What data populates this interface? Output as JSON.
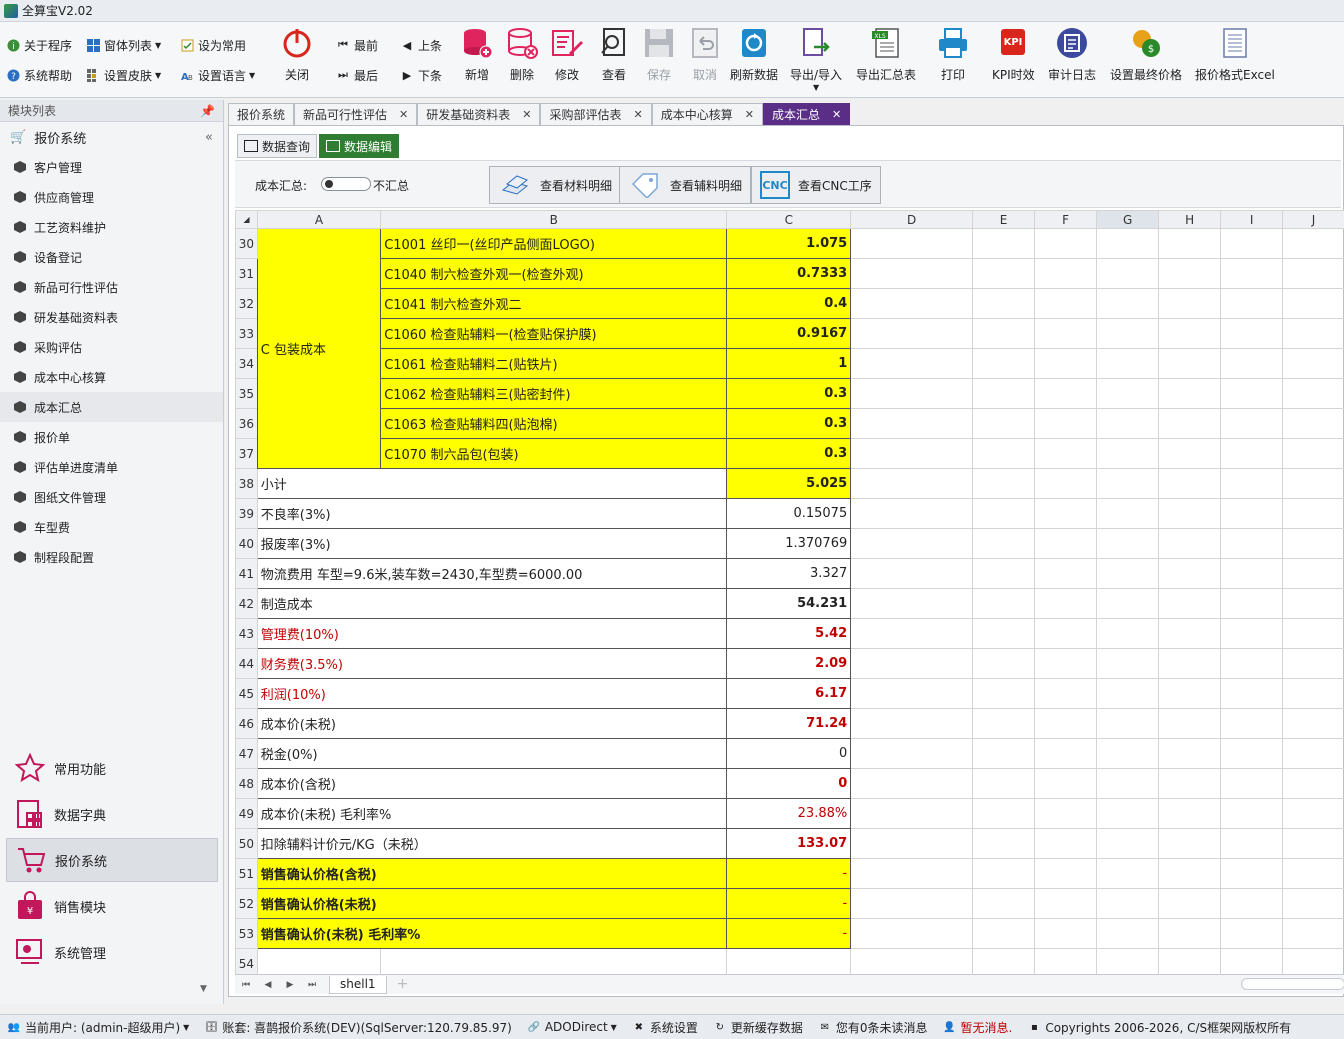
{
  "app": {
    "title": "全算宝V2.02"
  },
  "toolbar": {
    "small": [
      {
        "label": "关于程序",
        "icon": "info-icon",
        "caret": false
      },
      {
        "label": "窗体列表",
        "icon": "window-list-icon",
        "caret": true
      },
      {
        "label": "设为常用",
        "icon": "checklist-icon",
        "caret": false
      },
      {
        "label": "系统帮助",
        "icon": "help-icon",
        "caret": false
      },
      {
        "label": "设置皮肤",
        "icon": "skin-icon",
        "caret": true
      },
      {
        "label": "设置语言",
        "icon": "language-icon",
        "caret": true
      }
    ],
    "close": "关闭",
    "first": "最前",
    "last": "最后",
    "prev": "上条",
    "next": "下条",
    "add": "新增",
    "delete": "删除",
    "edit": "修改",
    "view": "查看",
    "save": "保存",
    "cancel": "取消",
    "refresh": "刷新数据",
    "import_export": "导出/导入",
    "export_summary": "导出汇总表",
    "print": "打印",
    "kpi": "KPI时效",
    "audit": "审计日志",
    "final_price": "设置最终价格",
    "excel": "报价格式Excel"
  },
  "sidebar": {
    "header": "模块列表",
    "group": "报价系统",
    "items": [
      "客户管理",
      "供应商管理",
      "工艺资料维护",
      "设备登记",
      "新品可行性评估",
      "研发基础资料表",
      "采购评估",
      "成本中心核算",
      "成本汇总",
      "报价单",
      "评估单进度清单",
      "图纸文件管理",
      "车型费",
      "制程段配置"
    ],
    "active_item": "成本汇总",
    "nav": [
      "常用功能",
      "数据字典",
      "报价系统",
      "销售模块",
      "系统管理"
    ]
  },
  "tabs": [
    {
      "label": "报价系统",
      "closable": false
    },
    {
      "label": "新品可行性评估",
      "closable": true
    },
    {
      "label": "研发基础资料表",
      "closable": true
    },
    {
      "label": "采购部评估表",
      "closable": true
    },
    {
      "label": "成本中心核算",
      "closable": true
    },
    {
      "label": "成本汇总",
      "closable": true,
      "active": true
    }
  ],
  "subtabs": [
    "数据查询",
    "数据编辑"
  ],
  "options": {
    "cost_summary_label": "成本汇总:",
    "toggle_label": "不汇总",
    "material_btn": "查看材料明细",
    "aux_btn": "查看辅料明细",
    "cnc_btn": "查看CNC工序",
    "cnc_icon_text": "CNC"
  },
  "sheet": {
    "columns": [
      "A",
      "B",
      "C",
      "D",
      "E",
      "F",
      "G",
      "H",
      "I",
      "J"
    ],
    "selected_column": "G",
    "merged_label": "C 包装成本",
    "group_rows": [
      {
        "row": "30",
        "item": "C1001 丝印一(丝印产品侧面LOGO)",
        "value": "1.075"
      },
      {
        "row": "31",
        "item": "C1040 制六检查外观一(检查外观)",
        "value": "0.7333"
      },
      {
        "row": "32",
        "item": "C1041 制六检查外观二",
        "value": "0.4"
      },
      {
        "row": "33",
        "item": "C1060 检查贴辅料一(检查贴保护膜)",
        "value": "0.9167"
      },
      {
        "row": "34",
        "item": "C1061 检查贴辅料二(贴铁片)",
        "value": "1"
      },
      {
        "row": "35",
        "item": "C1062 检查贴辅料三(贴密封件)",
        "value": "0.3"
      },
      {
        "row": "36",
        "item": "C1063 检查贴辅料四(贴泡棉)",
        "value": "0.3"
      },
      {
        "row": "37",
        "item": "C1070 制六品包(包装)",
        "value": "0.3"
      }
    ],
    "rows": [
      {
        "row": "38",
        "label": "小计",
        "value": "5.025",
        "style": "subtotal"
      },
      {
        "row": "39",
        "label": "不良率(3%)",
        "value": "0.15075",
        "style": "plain"
      },
      {
        "row": "40",
        "label": "报废率(3%)",
        "value": "1.370769",
        "style": "plain"
      },
      {
        "row": "41",
        "label": "物流费用 车型=9.6米,装车数=2430,车型费=6000.00",
        "value": "3.327",
        "style": "plain"
      },
      {
        "row": "42",
        "label": "制造成本",
        "value": "54.231",
        "style": "boldval"
      },
      {
        "row": "43",
        "label": "管理费(10%)",
        "value": "5.42",
        "style": "red"
      },
      {
        "row": "44",
        "label": "财务费(3.5%)",
        "value": "2.09",
        "style": "red"
      },
      {
        "row": "45",
        "label": "利润(10%)",
        "value": "6.17",
        "style": "red"
      },
      {
        "row": "46",
        "label": "成本价(未税)",
        "value": "71.24",
        "style": "redval"
      },
      {
        "row": "47",
        "label": "税金(0%)",
        "value": "0",
        "style": "plain"
      },
      {
        "row": "48",
        "label": "成本价(含税)",
        "value": "0",
        "style": "redval"
      },
      {
        "row": "49",
        "label": "成本价(未税) 毛利率%",
        "value": "23.88%",
        "style": "redval-normal"
      },
      {
        "row": "50",
        "label": "扣除辅料计价元/KG（未税）",
        "value": "133.07",
        "style": "redval"
      },
      {
        "row": "51",
        "label": "销售确认价格(含税)",
        "value": "-",
        "style": "sale"
      },
      {
        "row": "52",
        "label": "销售确认价格(未税)",
        "value": "-",
        "style": "sale"
      },
      {
        "row": "53",
        "label": "销售确认价(未税) 毛利率%",
        "value": "-",
        "style": "sale"
      }
    ],
    "empty_row": "54",
    "sheet_tab": "shell1"
  },
  "status": {
    "user": "当前用户: (admin-超级用户)",
    "account": "账套: 喜鹊报价系统(DEV)(SqlServer:120.79.85.97)",
    "ado": "ADODirect",
    "settings": "系统设置",
    "refresh_cache": "更新缓存数据",
    "messages": "您有0条未读消息",
    "no_msg": "暂无消息.",
    "copyright": "Copyrights 2006-2026, C/S框架网版权所有"
  },
  "colors": {
    "accent": "#5a2d86",
    "highlight": "#ffff00",
    "red": "#c00000",
    "green_tab": "#2e7d32"
  }
}
